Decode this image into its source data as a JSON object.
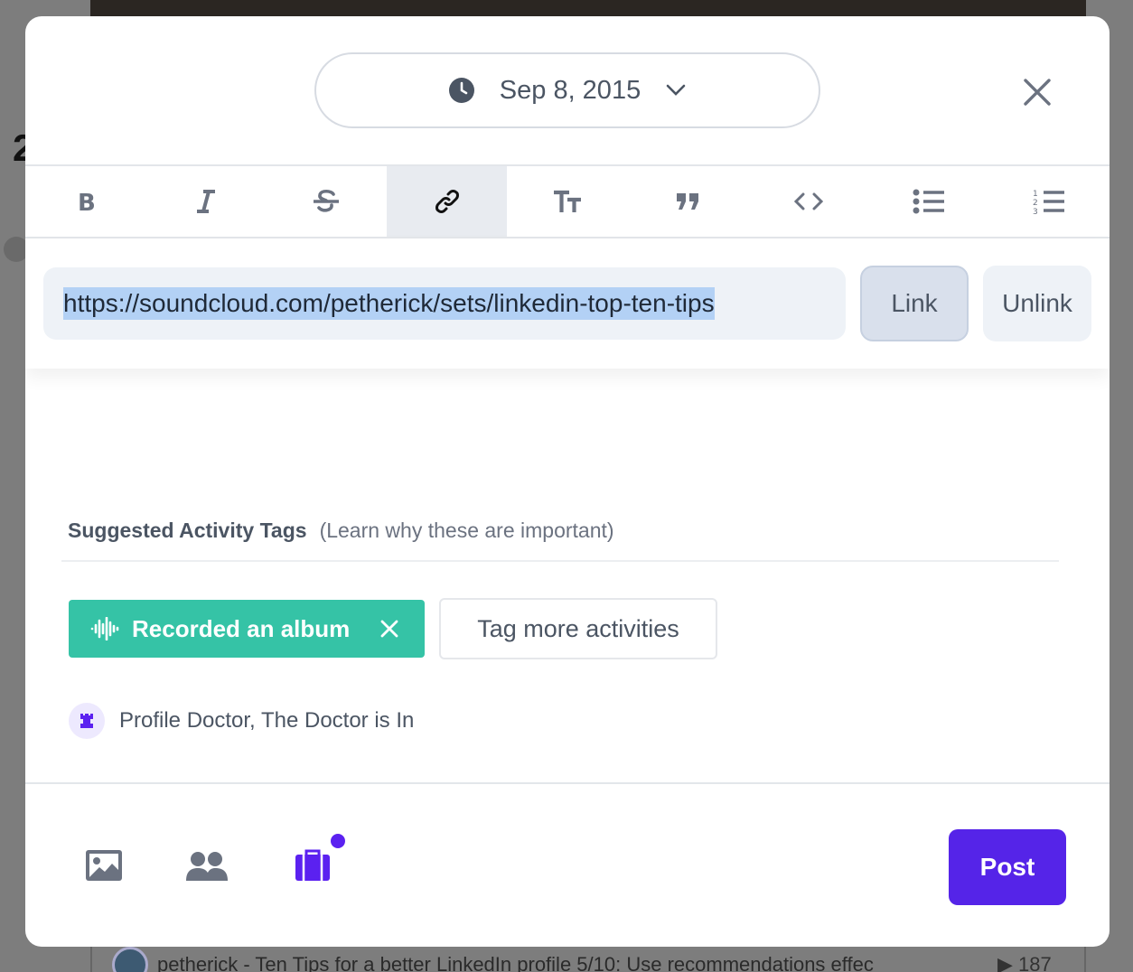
{
  "background": {
    "letter": "2",
    "feed_text": "petherick - Ten Tips for a better LinkedIn profile 5/10: Use recommendations effec",
    "plays": "▶ 187"
  },
  "date_picker": {
    "label": "Sep 8, 2015",
    "icon": "clock-icon"
  },
  "toolbar": {
    "buttons": [
      "bold",
      "italic",
      "strikethrough",
      "link",
      "text-size",
      "quote",
      "code",
      "bulleted-list",
      "numbered-list"
    ],
    "active": "link"
  },
  "link_editor": {
    "url": "https://soundcloud.com/petherick/sets/linkedin-top-ten-tips",
    "link_label": "Link",
    "unlink_label": "Unlink"
  },
  "tags": {
    "heading": "Suggested Activity Tags",
    "learn_link": "(Learn why these are important)",
    "selected_tag": "Recorded an album",
    "more_label": "Tag more activities"
  },
  "badge": {
    "text": "Profile Doctor, The Doctor is In"
  },
  "footer": {
    "post_label": "Post"
  },
  "colors": {
    "accent": "#5524e8",
    "tag": "#35c3a6",
    "selection": "#b3d1f5"
  }
}
